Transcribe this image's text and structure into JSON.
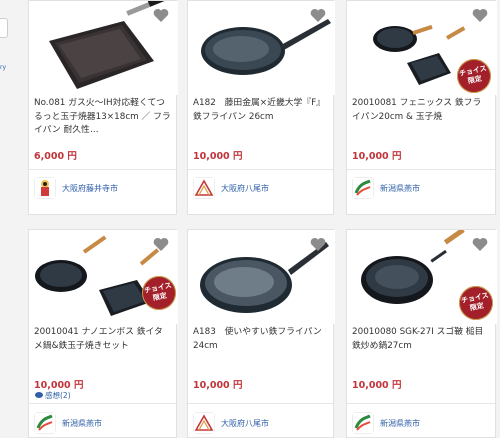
{
  "left_fragment": {
    "text": "ry"
  },
  "products": [
    {
      "name": "No.081 ガス火～IH対応軽くてつるっと玉子焼器13×18cm ／ フライパン 耐久性…",
      "price": "6,000 円",
      "municipality": "大阪府藤井寺市",
      "review": "",
      "badge": false
    },
    {
      "name": "A182　藤田金属×近畿大学『F』鉄フライパン 26cm",
      "price": "10,000 円",
      "municipality": "大阪府八尾市",
      "review": "",
      "badge": false
    },
    {
      "name": "20010081 フェニックス 鉄フライパン20cm & 玉子焼",
      "price": "10,000 円",
      "municipality": "新潟県燕市",
      "review": "",
      "badge": true
    },
    {
      "name": "20010041 ナノエンボス 鉄イタメ鍋&鉄玉子焼きセット",
      "price": "10,000 円",
      "municipality": "新潟県燕市",
      "review": "感想(2)",
      "badge": true
    },
    {
      "name": "A183　使いやすい鉄フライパン 24cm",
      "price": "10,000 円",
      "municipality": "大阪府八尾市",
      "review": "",
      "badge": false
    },
    {
      "name": "20010080 SGK-27I スゴ鞁 槌目鉄炒め鍋27cm",
      "price": "10,000 円",
      "municipality": "新潟県燕市",
      "review": "",
      "badge": true
    }
  ],
  "badge_text": {
    "line1": "チョイス",
    "line2": "限定"
  },
  "icons": {
    "favorite": "heart-icon",
    "review": "speech-bubble-icon"
  },
  "colors": {
    "price": "#c0343a",
    "link": "#2f5fa8",
    "badge": "#a3202b"
  }
}
